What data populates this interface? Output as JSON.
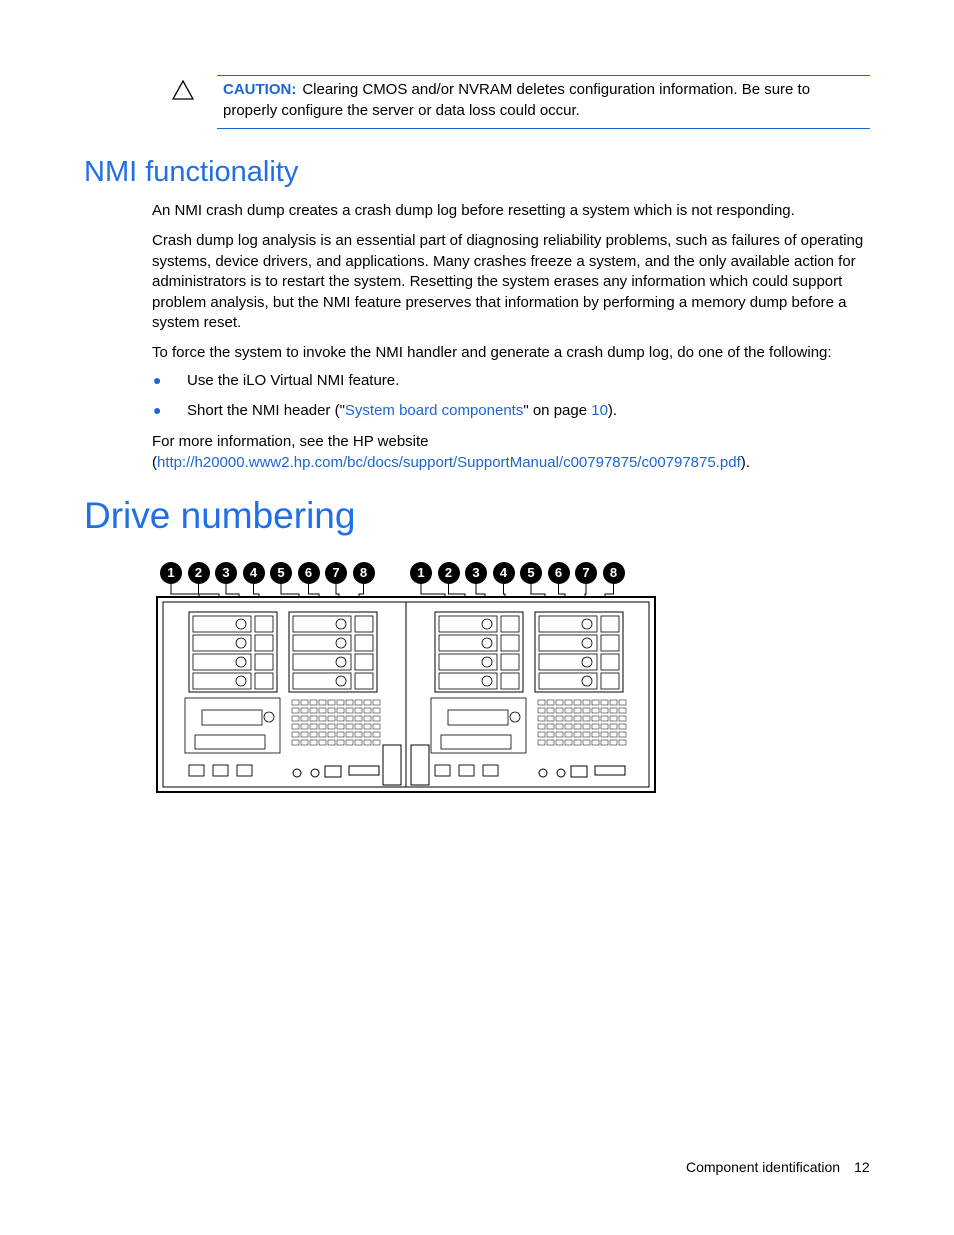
{
  "caution": {
    "icon": "warning-triangle-icon",
    "label": "CAUTION:",
    "text": "Clearing CMOS and/or NVRAM deletes configuration information. Be sure to properly configure the server or data loss could occur."
  },
  "nmi_section": {
    "heading": "NMI functionality",
    "para1": "An NMI crash dump creates a crash dump log before resetting a system which is not responding.",
    "para2": "Crash dump log analysis is an essential part of diagnosing reliability problems, such as failures of operating systems, device drivers, and applications. Many crashes freeze a system, and the only available action for administrators is to restart the system. Resetting the system erases any information which could support problem analysis, but the NMI feature preserves that information by performing a memory dump before a system reset.",
    "para3": "To force the system to invoke the NMI handler and generate a crash dump log, do one of the following:",
    "bullets": [
      {
        "text": "Use the iLO Virtual NMI feature."
      },
      {
        "prefix": "Short the NMI header (\"",
        "link": "System board components",
        "middle": "\" on page ",
        "page_link": "10",
        "suffix": ")."
      }
    ],
    "more_info": "For more information, see the HP website",
    "url_open": "(",
    "url": "http://h20000.www2.hp.com/bc/docs/support/SupportManual/c00797875/c00797875.pdf",
    "url_close": ")."
  },
  "drive_section": {
    "heading": "Drive numbering",
    "callouts_left": [
      "1",
      "2",
      "3",
      "4",
      "5",
      "6",
      "7",
      "8"
    ],
    "callouts_right": [
      "1",
      "2",
      "3",
      "4",
      "5",
      "6",
      "7",
      "8"
    ]
  },
  "footer": {
    "section": "Component identification",
    "page": "12"
  },
  "colors": {
    "accent": "#1b66d4",
    "heading": "#1f6fe5"
  }
}
